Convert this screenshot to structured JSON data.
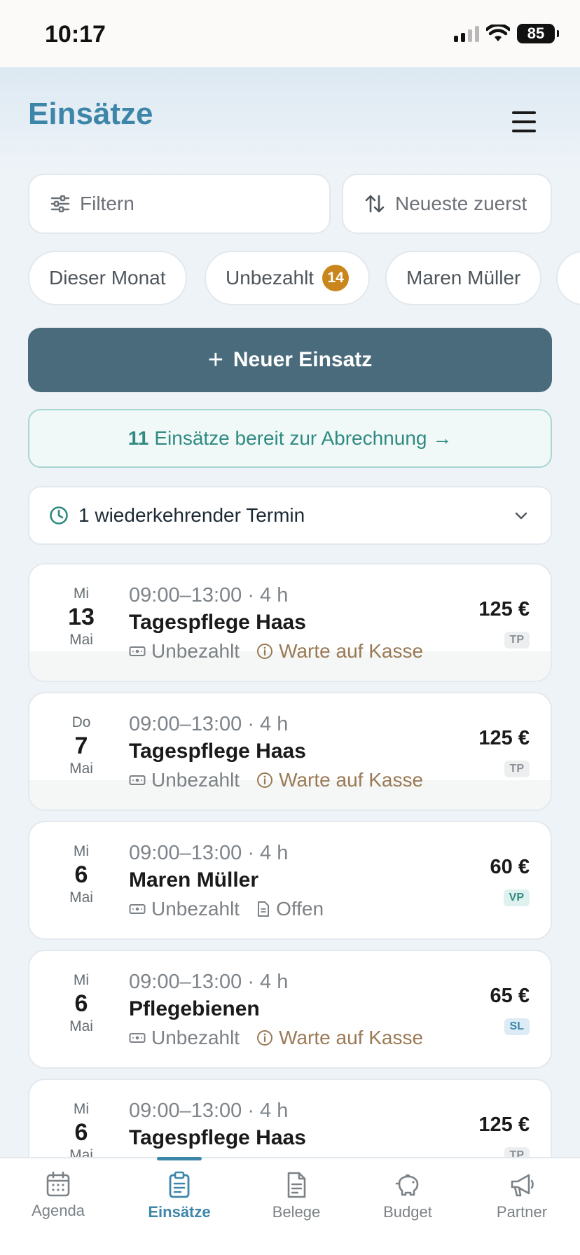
{
  "status_bar": {
    "time": "10:17",
    "battery": "85"
  },
  "header": {
    "title": "Einsätze"
  },
  "toolbar": {
    "filter_label": "Filtern",
    "sort_label": "Neueste zuerst"
  },
  "chips": [
    {
      "label": "Dieser Monat"
    },
    {
      "label": "Unbezahlt",
      "badge": "14"
    },
    {
      "label": "Maren Müller"
    }
  ],
  "new_button": {
    "plus": "+",
    "label": "Neuer Einsatz"
  },
  "ready_banner": {
    "count": "11",
    "text": "Einsätze bereit zur Abrechnung →"
  },
  "recurring": {
    "label": "1 wiederkehrender Termin"
  },
  "entries": [
    {
      "dow": "Mi",
      "day": "13",
      "month": "Mai",
      "time": "09:00–13:00 · 4 h",
      "name": "Tagespflege Haas",
      "payment": "Unbezahlt",
      "state": "Warte auf Kasse",
      "amount": "125 €",
      "tag": "TP"
    },
    {
      "dow": "Do",
      "day": "7",
      "month": "Mai",
      "time": "09:00–13:00 · 4 h",
      "name": "Tagespflege Haas",
      "payment": "Unbezahlt",
      "state": "Warte auf Kasse",
      "amount": "125 €",
      "tag": "TP"
    },
    {
      "dow": "Mi",
      "day": "6",
      "month": "Mai",
      "time": "09:00–13:00 · 4 h",
      "name": "Maren Müller",
      "payment": "Unbezahlt",
      "state": "Offen",
      "amount": "60 €",
      "tag": "VP"
    },
    {
      "dow": "Mi",
      "day": "6",
      "month": "Mai",
      "time": "09:00–13:00 · 4 h",
      "name": "Pflegebienen",
      "payment": "Unbezahlt",
      "state": "Warte auf Kasse",
      "amount": "65 €",
      "tag": "SL"
    },
    {
      "dow": "Mi",
      "day": "6",
      "month": "Mai",
      "time": "09:00–13:00 · 4 h",
      "name": "Tagespflege Haas",
      "payment": "",
      "state": "",
      "amount": "125 €",
      "tag": "TP"
    }
  ],
  "tabs": [
    {
      "label": "Agenda",
      "icon": "calendar-icon"
    },
    {
      "label": "Einsätze",
      "icon": "clipboard-icon",
      "active": true
    },
    {
      "label": "Belege",
      "icon": "document-icon"
    },
    {
      "label": "Budget",
      "icon": "piggy-bank-icon"
    },
    {
      "label": "Partner",
      "icon": "megaphone-icon"
    }
  ],
  "colors": {
    "accent": "#3d86a9",
    "primary_button": "#4a6b7c",
    "badge": "#c9861c",
    "waiting": "#9a7a55",
    "ready": "#2f8a80"
  }
}
